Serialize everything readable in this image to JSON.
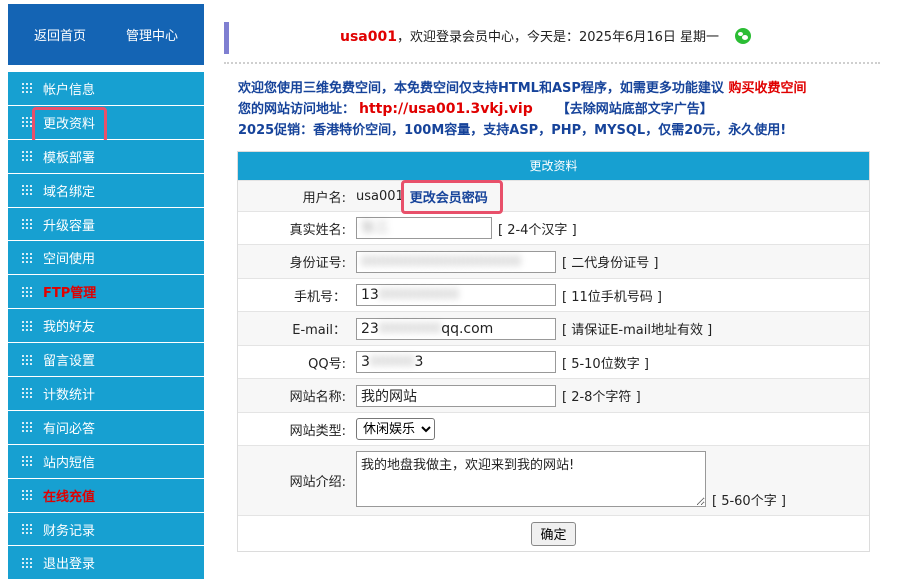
{
  "header": {
    "home_link": "返回首页",
    "admin_link": "管理中心"
  },
  "sidebar": {
    "items": [
      {
        "label": "帐户信息",
        "red": false
      },
      {
        "label": "更改资料",
        "red": false
      },
      {
        "label": "模板部署",
        "red": false
      },
      {
        "label": "域名绑定",
        "red": false
      },
      {
        "label": "升级容量",
        "red": false
      },
      {
        "label": "空间使用",
        "red": false
      },
      {
        "label": "FTP管理",
        "red": true
      },
      {
        "label": "我的好友",
        "red": false
      },
      {
        "label": "留言设置",
        "red": false
      },
      {
        "label": "计数统计",
        "red": false
      },
      {
        "label": "有问必答",
        "red": false
      },
      {
        "label": "站内短信",
        "red": false
      },
      {
        "label": "在线充值",
        "red": true
      },
      {
        "label": "财务记录",
        "red": false
      },
      {
        "label": "退出登录",
        "red": false
      }
    ]
  },
  "topbar": {
    "username": "usa001",
    "welcome_text": "，欢迎登录会员中心，今天是：2025年6月16日 星期一"
  },
  "notice": {
    "line1": "欢迎您使用三维免费空间，本免费空间仅支持HTML和ASP程序，如需更多功能建议",
    "buy_link": "购买收费空间",
    "url_label": "您的网站访问地址：",
    "url": "http://usa001.3vkj.vip",
    "remove_ad": "【去除网站底部文字广告】",
    "promo": "2025促销：香港特价空间，100M容量，支持ASP，PHP，MYSQL，仅需20元，永久使用!"
  },
  "form": {
    "title": "更改资料",
    "username_label": "用户名:",
    "username_value": "usa001",
    "change_password": "更改会员密码",
    "realname_label": "真实姓名:",
    "realname_value": "张三",
    "realname_hint": "[ 2-4个汉字 ]",
    "idcard_label": "身份证号:",
    "idcard_value": "000000000000000000",
    "idcard_hint": "[ 二代身份证号 ]",
    "mobile_label": "手机号：",
    "mobile_prefix": "13",
    "mobile_hidden": "000000000",
    "mobile_hint": "[ 11位手机号码 ]",
    "email_label": "E-mail：",
    "email_prefix": "23",
    "email_hidden": "0000000",
    "email_suffix": "qq.com",
    "email_hint": "[ 请保证E-mail地址有效 ]",
    "qq_label": "QQ号:",
    "qq_prefix": "3",
    "qq_hidden": "00000",
    "qq_suffix": "3",
    "qq_hint": "[ 5-10位数字 ]",
    "sitename_label": "网站名称:",
    "sitename_value": "我的网站",
    "sitename_hint": "[ 2-8个字符 ]",
    "sitetype_label": "网站类型:",
    "sitetype_value": "休闲娱乐",
    "intro_label": "网站介绍:",
    "intro_value": "我的地盘我做主，欢迎来到我的网站!",
    "intro_hint": "[ 5-60个字 ]",
    "submit_label": "确定"
  }
}
